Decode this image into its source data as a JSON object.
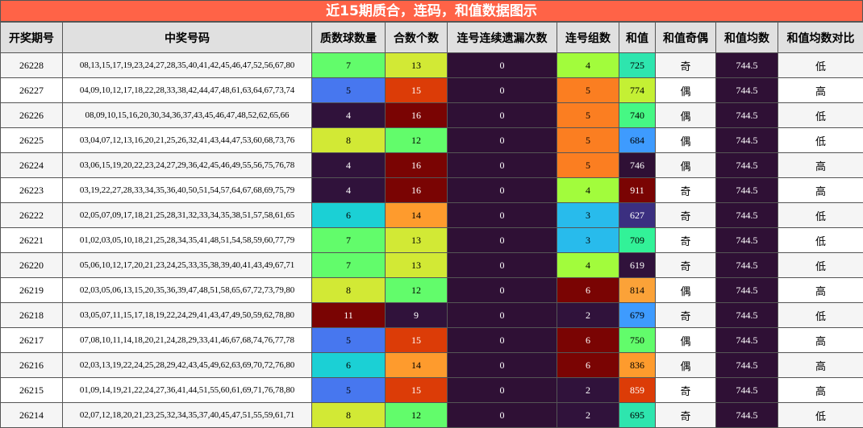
{
  "title": "近15期质合，连码，和值数据图示",
  "headers": [
    "开奖期号",
    "中奖号码",
    "质数球数量",
    "合数个数",
    "连号连续遗漏次数",
    "连号组数",
    "和值",
    "和值奇偶",
    "和值均数",
    "和值均数对比"
  ],
  "rows": [
    {
      "issue": "26228",
      "numbers": "08,13,15,17,19,23,24,27,28,35,40,41,42,45,46,47,52,56,67,80",
      "primes": "7",
      "composites": "13",
      "consec_miss": "0",
      "consec_groups": "4",
      "sum": "725",
      "parity": "奇",
      "avg": "744.5",
      "compare": "低"
    },
    {
      "issue": "26227",
      "numbers": "04,09,10,12,17,18,22,28,33,38,42,44,47,48,61,63,64,67,73,74",
      "primes": "5",
      "composites": "15",
      "consec_miss": "0",
      "consec_groups": "5",
      "sum": "774",
      "parity": "偶",
      "avg": "744.5",
      "compare": "高"
    },
    {
      "issue": "26226",
      "numbers": "08,09,10,15,16,20,30,34,36,37,43,45,46,47,48,52,62,65,66",
      "primes": "4",
      "composites": "16",
      "consec_miss": "0",
      "consec_groups": "5",
      "sum": "740",
      "parity": "偶",
      "avg": "744.5",
      "compare": "低"
    },
    {
      "issue": "26225",
      "numbers": "03,04,07,12,13,16,20,21,25,26,32,41,43,44,47,53,60,68,73,76",
      "primes": "8",
      "composites": "12",
      "consec_miss": "0",
      "consec_groups": "5",
      "sum": "684",
      "parity": "偶",
      "avg": "744.5",
      "compare": "低"
    },
    {
      "issue": "26224",
      "numbers": "03,06,15,19,20,22,23,24,27,29,36,42,45,46,49,55,56,75,76,78",
      "primes": "4",
      "composites": "16",
      "consec_miss": "0",
      "consec_groups": "5",
      "sum": "746",
      "parity": "偶",
      "avg": "744.5",
      "compare": "高"
    },
    {
      "issue": "26223",
      "numbers": "03,19,22,27,28,33,34,35,36,40,50,51,54,57,64,67,68,69,75,79",
      "primes": "4",
      "composites": "16",
      "consec_miss": "0",
      "consec_groups": "4",
      "sum": "911",
      "parity": "奇",
      "avg": "744.5",
      "compare": "高"
    },
    {
      "issue": "26222",
      "numbers": "02,05,07,09,17,18,21,25,28,31,32,33,34,35,38,51,57,58,61,65",
      "primes": "6",
      "composites": "14",
      "consec_miss": "0",
      "consec_groups": "3",
      "sum": "627",
      "parity": "奇",
      "avg": "744.5",
      "compare": "低"
    },
    {
      "issue": "26221",
      "numbers": "01,02,03,05,10,18,21,25,28,34,35,41,48,51,54,58,59,60,77,79",
      "primes": "7",
      "composites": "13",
      "consec_miss": "0",
      "consec_groups": "3",
      "sum": "709",
      "parity": "奇",
      "avg": "744.5",
      "compare": "低"
    },
    {
      "issue": "26220",
      "numbers": "05,06,10,12,17,20,21,23,24,25,33,35,38,39,40,41,43,49,67,71",
      "primes": "7",
      "composites": "13",
      "consec_miss": "0",
      "consec_groups": "4",
      "sum": "619",
      "parity": "奇",
      "avg": "744.5",
      "compare": "低"
    },
    {
      "issue": "26219",
      "numbers": "02,03,05,06,13,15,20,35,36,39,47,48,51,58,65,67,72,73,79,80",
      "primes": "8",
      "composites": "12",
      "consec_miss": "0",
      "consec_groups": "6",
      "sum": "814",
      "parity": "偶",
      "avg": "744.5",
      "compare": "高"
    },
    {
      "issue": "26218",
      "numbers": "03,05,07,11,15,17,18,19,22,24,29,41,43,47,49,50,59,62,78,80",
      "primes": "11",
      "composites": "9",
      "consec_miss": "0",
      "consec_groups": "2",
      "sum": "679",
      "parity": "奇",
      "avg": "744.5",
      "compare": "低"
    },
    {
      "issue": "26217",
      "numbers": "07,08,10,11,14,18,20,21,24,28,29,33,41,46,67,68,74,76,77,78",
      "primes": "5",
      "composites": "15",
      "consec_miss": "0",
      "consec_groups": "6",
      "sum": "750",
      "parity": "偶",
      "avg": "744.5",
      "compare": "高"
    },
    {
      "issue": "26216",
      "numbers": "02,03,13,19,22,24,25,28,29,42,43,45,49,62,63,69,70,72,76,80",
      "primes": "6",
      "composites": "14",
      "consec_miss": "0",
      "consec_groups": "6",
      "sum": "836",
      "parity": "偶",
      "avg": "744.5",
      "compare": "高"
    },
    {
      "issue": "26215",
      "numbers": "01,09,14,19,21,22,24,27,36,41,44,51,55,60,61,69,71,76,78,80",
      "primes": "5",
      "composites": "15",
      "consec_miss": "0",
      "consec_groups": "2",
      "sum": "859",
      "parity": "奇",
      "avg": "744.5",
      "compare": "高"
    },
    {
      "issue": "26214",
      "numbers": "02,07,12,18,20,21,23,25,32,34,35,37,40,45,47,51,55,59,61,71",
      "primes": "8",
      "composites": "12",
      "consec_miss": "0",
      "consec_groups": "2",
      "sum": "695",
      "parity": "奇",
      "avg": "744.5",
      "compare": "低"
    }
  ],
  "colors": {
    "title_bg": "#ff6347",
    "header_bg": "#e0e0e0",
    "dark_purple": "#2f1035",
    "dark_red": "#7a0403",
    "count_palette": {
      "2": "#30123b",
      "3": "#28bbec",
      "4": "#a2fc3c",
      "5": "#fb7e21",
      "6": "#7a0403",
      "7": "#62fc6b",
      "8": "#d2e935",
      "9": "#30123b",
      "11": "#7a0403",
      "12": "#62fc6b",
      "13": "#d2e935",
      "14": "#fe9b2d",
      "15": "#dc3c07",
      "16": "#7a0403"
    },
    "prime_palette": {
      "4": "#30123b",
      "5": "#4777ef",
      "6": "#1bd0d5",
      "7": "#62fc6b",
      "8": "#d2e935",
      "11": "#7a0403"
    },
    "sum_palette": {
      "725": "#2ee5ae",
      "774": "#c4f034",
      "740": "#46f884",
      "684": "#3e9bfe",
      "746": "#2f1035",
      "911": "#7a0403",
      "627": "#3b2f80",
      "709": "#32f298",
      "619": "#30123b",
      "814": "#fba238",
      "679": "#3e9bfe",
      "750": "#62fc6b",
      "836": "#fe9b2d",
      "859": "#dc3c07",
      "695": "#2ee5ae"
    }
  }
}
